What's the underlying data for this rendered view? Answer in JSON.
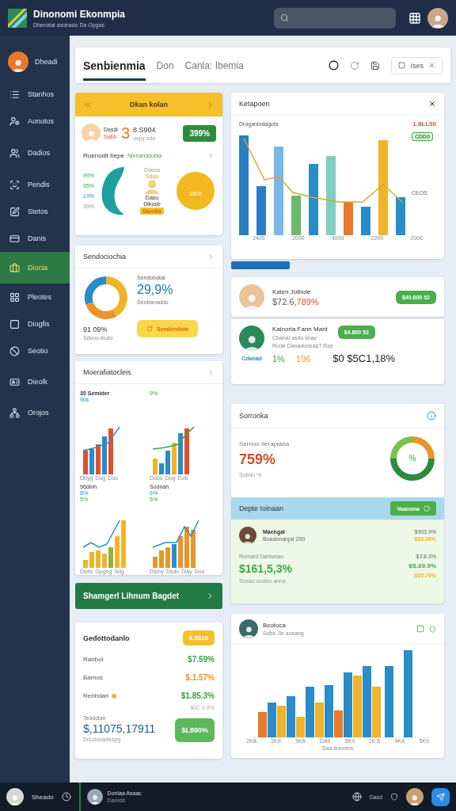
{
  "header": {
    "title": "Dinonomi Ekonmpia",
    "subtitle": "Dhenalai asonado Da Opgas"
  },
  "sidebar": {
    "user": "Dheadi",
    "items": [
      {
        "label": "Stanhos",
        "selected": false
      },
      {
        "label": "Aonotos",
        "selected": false
      },
      {
        "label": "Dadios",
        "selected": false
      },
      {
        "label": "Pendis",
        "selected": false
      },
      {
        "label": "Stetos",
        "selected": false
      },
      {
        "label": "Danis",
        "selected": false
      },
      {
        "label": "Diocia",
        "selected": true
      },
      {
        "label": "Pleotes",
        "selected": false
      },
      {
        "label": "Diogfis",
        "selected": false
      },
      {
        "label": "Seotio",
        "selected": false
      },
      {
        "label": "Dieolk",
        "selected": false
      },
      {
        "label": "Orojos",
        "selected": false
      }
    ]
  },
  "tabs": [
    {
      "label": "Senbienmia",
      "selected": true
    },
    {
      "label": "Don",
      "selected": false
    },
    {
      "label": "Canla: Ibemia",
      "selected": false
    }
  ],
  "tab_action": "Ises",
  "summary_card": {
    "title": "Dkan kolan",
    "person": "Dasdi",
    "person_sub": "Sabb",
    "figure": "3",
    "figure_value": "8.S904",
    "figure_sub": "ospy sdo",
    "badge": "399%",
    "section": "Ruenodit bepe",
    "section_link": "Nlenanddobia",
    "legend": [
      "99%",
      "95%",
      "19%",
      "39%"
    ],
    "label_1": "Dseca",
    "label_2": "Sdoo",
    "person_label": "Dasu",
    "person_label_2": "Dikosb",
    "person_tag": "Gandla",
    "blob_value": "36%"
  },
  "donut_card": {
    "title": "Sendociochia",
    "label": "Sendobatar",
    "value": "29,9%",
    "sub": "Senbanaddo",
    "bottom_value": "91 09%",
    "bottom_sub": "Sdvoo dodo",
    "button": "Sendendoin"
  },
  "mini_charts": {
    "title": "Moerafiatocleis",
    "charts": [
      {
        "title": "30 Semider",
        "notes": [
          "9ds"
        ],
        "xlabels": [
          "Dbyg",
          "Dog",
          "Doo"
        ]
      },
      {
        "title": "9%",
        "xlabels": [
          "Dobo",
          "Dog",
          "Dob"
        ]
      },
      {
        "title": "96dinh",
        "notes": [
          "8%",
          "5%"
        ],
        "xlabels": [
          "Dsdo",
          "Gpgng",
          "Sdg"
        ]
      },
      {
        "title": "Sodnah",
        "notes": [
          "6%",
          "5%"
        ],
        "xlabels": [
          "Dsmy",
          "Dsdo",
          "Dwy",
          "Dvo"
        ]
      }
    ]
  },
  "green_button": "Shamgerl Lihnum Bagdet",
  "totals_card": {
    "title": "Gedottodanlo",
    "badge": "8.5610",
    "rows": [
      {
        "label": "Ranbol",
        "value": "$7.59%",
        "color": "#3a9f45",
        "dot": false
      },
      {
        "label": "Bamos",
        "value": "$.1.57%",
        "color": "#e8952a",
        "dot": false
      },
      {
        "label": "Renbdan",
        "value": "$1.85.3%",
        "color": "#3a9f45",
        "dot": true
      }
    ],
    "extra": "$0C.6.9%",
    "total_label": "Teodolan",
    "total": "$,11075,17911",
    "total_sub": "Ddodonadsspg",
    "button": "$L890%"
  },
  "chart_card": {
    "title": "Ketapoen",
    "subtitle": "Droganiodagots",
    "value": "1.8LL90",
    "tag": "CDD0",
    "end_label": "CEOS",
    "xlabels": [
      "2400",
      "2000",
      "4000",
      "2200",
      "2006"
    ]
  },
  "people": [
    {
      "name": "Kalen Jothole",
      "amount": "$72.6,",
      "change": "789%",
      "button": "$40.800 52"
    },
    {
      "name": "Kainoria Fann Mant",
      "line_1": "Cbanai asdo snav",
      "line_2": "Rode Danadonsap7 Ras",
      "tag": "Cdanad",
      "stat_1": "1%",
      "stat_2": "196",
      "amount": "$0 $5C1,18%",
      "button": "$4.800 52"
    }
  ],
  "gauge_card": {
    "title": "Sorronka",
    "label": "Sernoo Ilerapiana",
    "value": "759%",
    "sub": "Sobdo %",
    "center": "%"
  },
  "list_card": {
    "title": "Depte Ioinaan",
    "button": "Vaanona",
    "person": "Maengal",
    "person_sub": "Boadonanpd 290",
    "value_1": "$903.9%",
    "value_2": "$52.36%",
    "row_label": "Romanl Danlonan",
    "row_value": "$3.8.3%",
    "big": "$161,5,3%",
    "big_sub": "Sxead aodeo anna",
    "value_3": "$S.69.9%",
    "value_4": "$35.76%"
  },
  "bar_card": {
    "name": "Bcotoca",
    "sub": "Sdbs Jin aosang",
    "xlabels": [
      "2KA",
      "2K9",
      "3KA",
      "DA9",
      "5K9",
      "2K.6",
      "4KA",
      "5K9"
    ],
    "xlabel": "Saa anonms"
  },
  "footer": {
    "user": "Sheado",
    "item": "Donlaa Asaac",
    "item_sub": "Danidd",
    "status": "Dasd"
  }
}
